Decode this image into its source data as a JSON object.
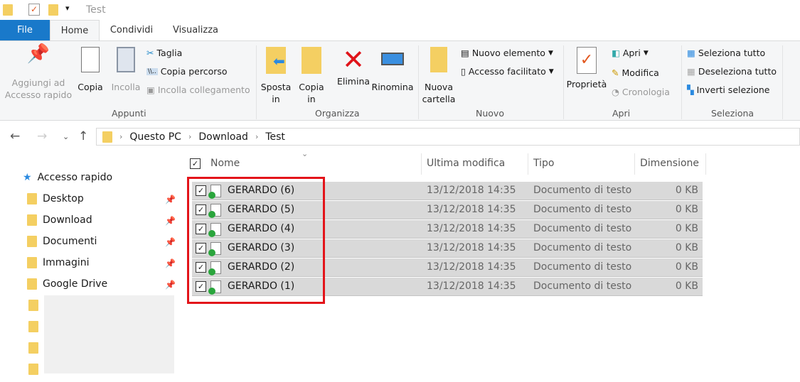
{
  "window": {
    "title": "Test"
  },
  "tabs": [
    {
      "label": "File"
    },
    {
      "label": "Home"
    },
    {
      "label": "Condividi"
    },
    {
      "label": "Visualizza"
    }
  ],
  "ribbon": {
    "appunti": {
      "label": "Appunti",
      "pin": "Aggiungi ad Accesso rapido",
      "copia": "Copia",
      "incolla": "Incolla",
      "taglia": "Taglia",
      "copia_percorso": "Copia percorso",
      "incolla_collegamento": "Incolla collegamento"
    },
    "organizza": {
      "label": "Organizza",
      "sposta": "Sposta in",
      "copia_in": "Copia in",
      "elimina": "Elimina",
      "rinomina": "Rinomina"
    },
    "nuovo": {
      "label": "Nuovo",
      "nuova_cartella": "Nuova cartella",
      "nuovo_elemento": "Nuovo elemento",
      "accesso_facilitato": "Accesso facilitato"
    },
    "apri": {
      "label": "Apri",
      "proprieta": "Proprietà",
      "apri": "Apri",
      "modifica": "Modifica",
      "cronologia": "Cronologia"
    },
    "seleziona": {
      "label": "Seleziona",
      "tutto": "Seleziona tutto",
      "deseleziona": "Deseleziona tutto",
      "inverti": "Inverti selezione"
    }
  },
  "breadcrumb": [
    "Questo PC",
    "Download",
    "Test"
  ],
  "nav": {
    "quick": "Accesso rapido",
    "items": [
      {
        "label": "Desktop"
      },
      {
        "label": "Download"
      },
      {
        "label": "Documenti"
      },
      {
        "label": "Immagini"
      },
      {
        "label": "Google Drive"
      }
    ]
  },
  "columns": {
    "name": "Nome",
    "modified": "Ultima modifica",
    "type": "Tipo",
    "size": "Dimensione"
  },
  "files": [
    {
      "name": "GERARDO (6)",
      "modified": "13/12/2018 14:35",
      "type": "Documento di testo",
      "size": "0 KB"
    },
    {
      "name": "GERARDO (5)",
      "modified": "13/12/2018 14:35",
      "type": "Documento di testo",
      "size": "0 KB"
    },
    {
      "name": "GERARDO (4)",
      "modified": "13/12/2018 14:35",
      "type": "Documento di testo",
      "size": "0 KB"
    },
    {
      "name": "GERARDO (3)",
      "modified": "13/12/2018 14:35",
      "type": "Documento di testo",
      "size": "0 KB"
    },
    {
      "name": "GERARDO (2)",
      "modified": "13/12/2018 14:35",
      "type": "Documento di testo",
      "size": "0 KB"
    },
    {
      "name": "GERARDO (1)",
      "modified": "13/12/2018 14:35",
      "type": "Documento di testo",
      "size": "0 KB"
    }
  ],
  "colors": {
    "accent": "#1979ca",
    "highlight": "#e3141a",
    "selection": "#d9d9d9"
  }
}
